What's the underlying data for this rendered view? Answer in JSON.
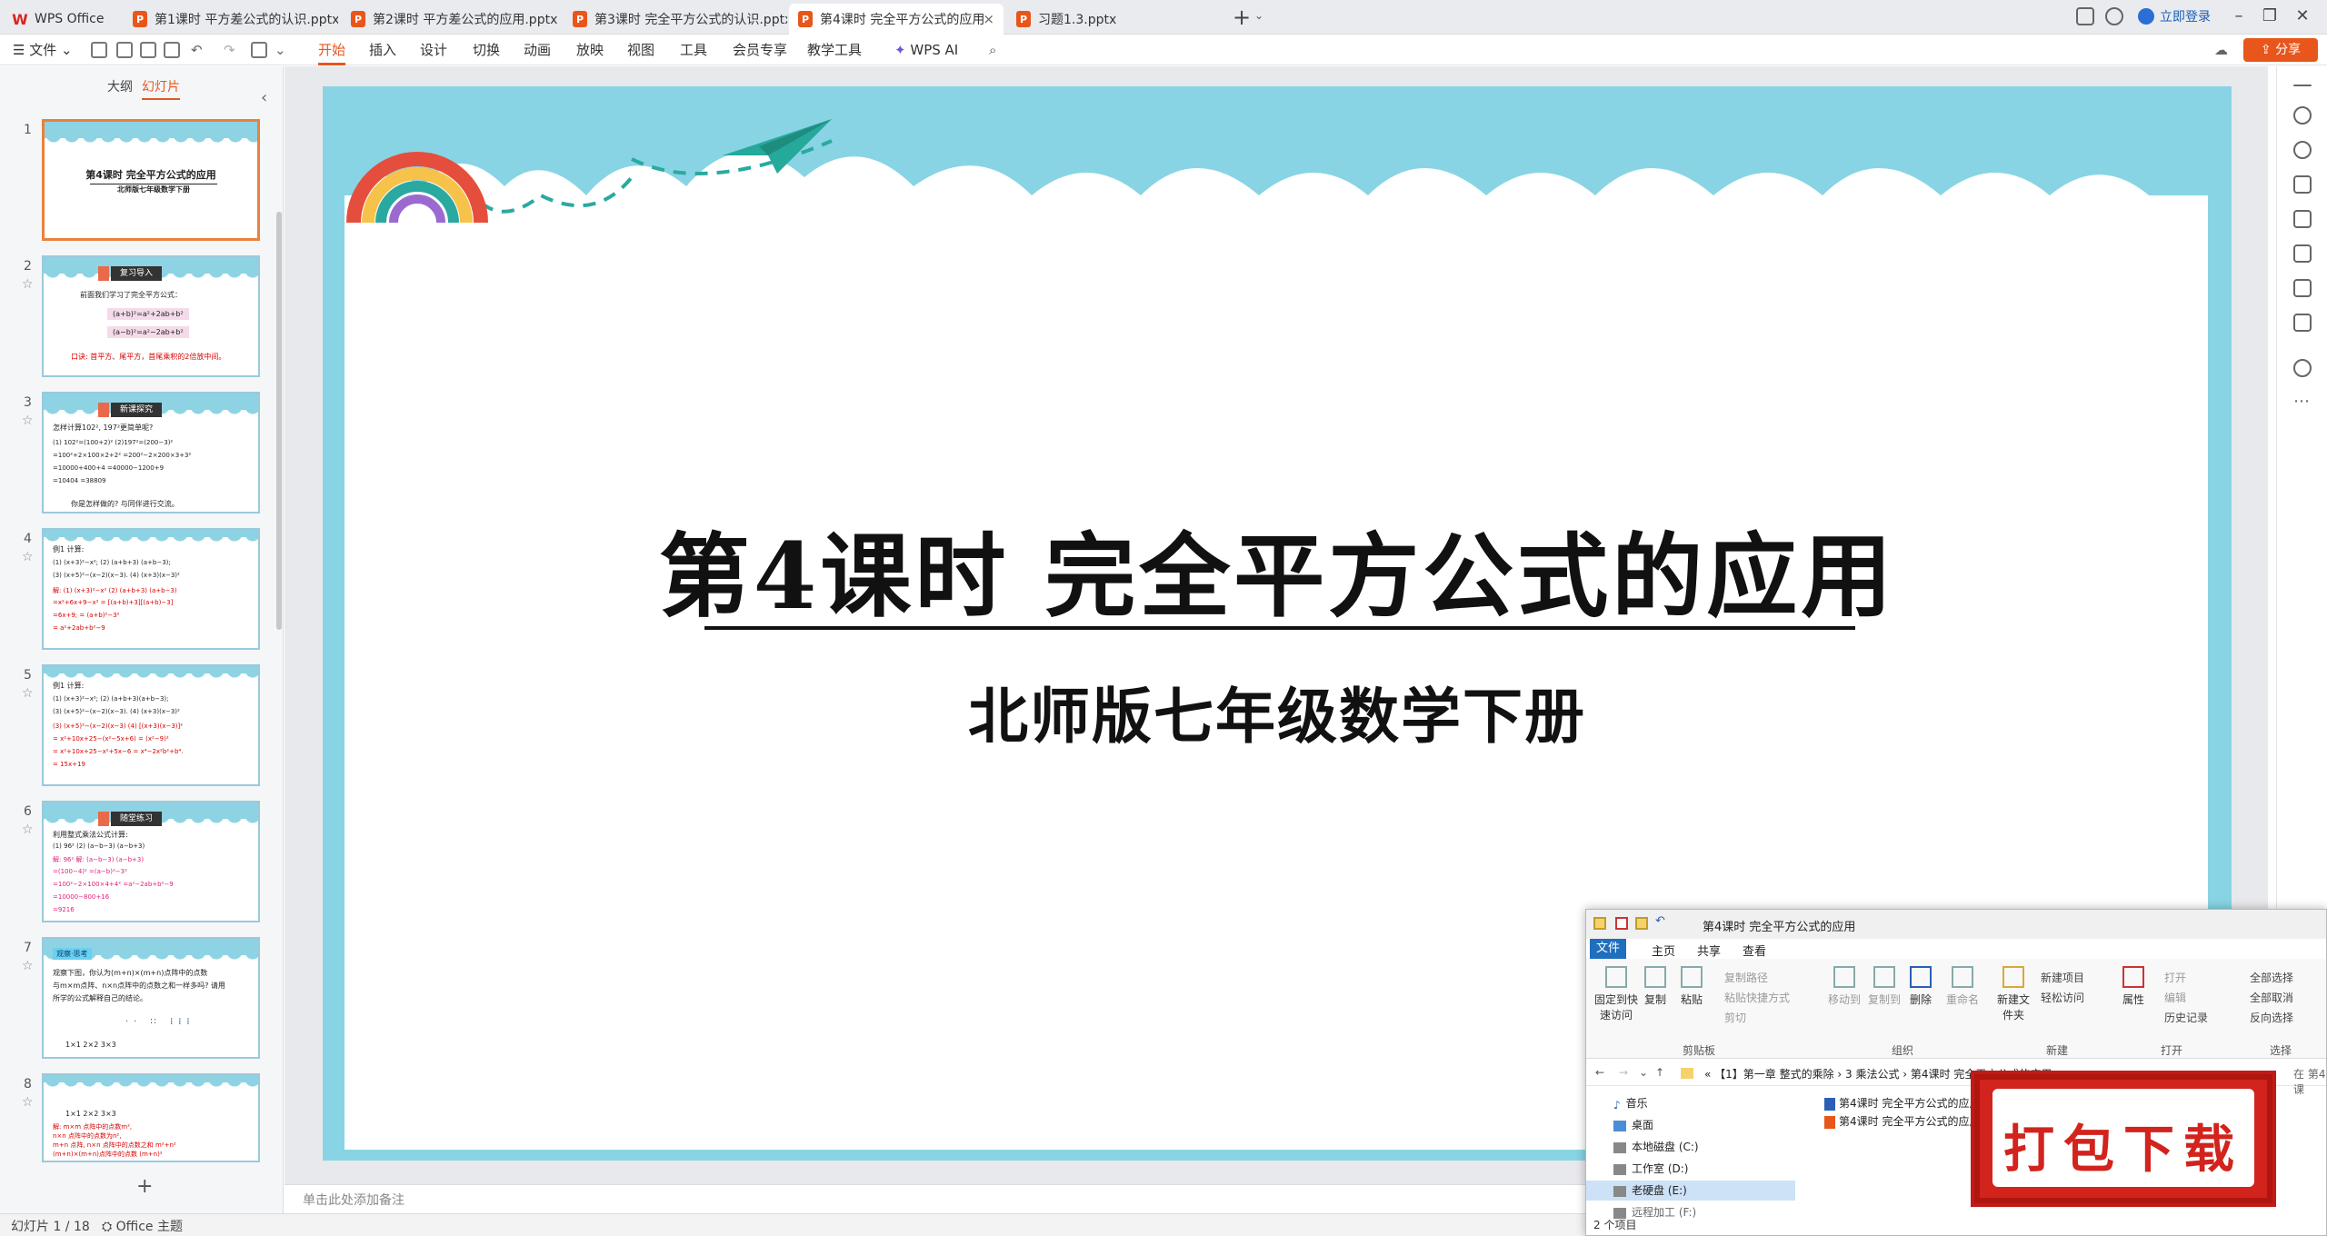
{
  "tabs": [
    {
      "label": "WPS Office",
      "icon": "wps-logo-icon"
    },
    {
      "label": "第1课时  平方差公式的认识.pptx",
      "icon": "P"
    },
    {
      "label": "第2课时  平方差公式的应用.pptx",
      "icon": "P"
    },
    {
      "label": "第3课时  完全平方公式的认识.pptx",
      "icon": "P"
    },
    {
      "label": "第4课时  完全平方公式的应用",
      "icon": "P"
    },
    {
      "label": "习题1.3.pptx",
      "icon": "P"
    }
  ],
  "login_label": "立即登录",
  "menu": {
    "file": "文件",
    "items": [
      "开始",
      "插入",
      "设计",
      "切换",
      "动画",
      "放映",
      "视图",
      "工具",
      "会员专享",
      "教学工具"
    ],
    "wps_ai": "WPS AI",
    "share": "分享"
  },
  "panel": {
    "outline_tab": "大纲",
    "slides_tab": "幻灯片",
    "add_slide": "+"
  },
  "thumbs": [
    {
      "num": "1",
      "title": "第4课时  完全平方公式的应用",
      "subtitle": "北师版七年级数学下册"
    },
    {
      "num": "2",
      "badge": "复习导入",
      "lines": [
        "前面我们学习了完全平方公式：",
        "(a+b)²=a²+2ab+b²",
        "(a−b)²=a²−2ab+b²",
        "口诀: 首平方、尾平方，首尾乘积的2倍放中间。"
      ]
    },
    {
      "num": "3",
      "badge": "新课探究",
      "lines": [
        "怎样计算102², 197²更简单呢?",
        "(1) 102²=(100+2)²       (2)197²=(200−3)²",
        "=100²+2×100×2+2²        =200²−2×200×3+3²",
        "=10000+400+4            =40000−1200+9",
        "=10404                  =38809",
        "你是怎样做的? 与同伴进行交流。"
      ]
    },
    {
      "num": "4",
      "lines": [
        "例1  计算:",
        "(1) (x+3)²−x²;        (2) (a+b+3) (a+b−3);",
        "(3) (x+5)²−(x−2)(x−3).  (4) (x+3)(x−3)²",
        "解: (1) (x+3)²−x²       (2) (a+b+3) (a+b−3)",
        "=x²+6x+9−x²              = [(a+b)+3][(a+b)−3]",
        "=6x+9;                   = (a+b)²−3²",
        "                         = a²+2ab+b²−9"
      ]
    },
    {
      "num": "5",
      "lines": [
        "例1  计算:",
        "(1) (x+3)²−x²;        (2) (a+b+3)(a+b−3);",
        "(3) (x+5)²−(x−2)(x−3).  (4) (x+3)(x−3)²",
        "(3) (x+5)²−(x−2)(x−3)   (4) [(x+3)(x−3)]²",
        "= x²+10x+25−(x²−5x+6)   = (x²−9)²",
        "= x²+10x+25−x²+5x−6     = x⁴−2x²b²+b⁴.",
        "= 15x+19"
      ]
    },
    {
      "num": "6",
      "badge": "随堂练习",
      "lines": [
        "利用整式乘法公式计算:",
        "(1) 96²                (2) (a−b−3) (a−b+3)",
        "解: 96²                 解: (a−b−3) (a−b+3)",
        "=(100−4)²                =(a−b)²−3²",
        "=100²−2×100×4+4²         =a²−2ab+b²−9",
        "=10000−800+16",
        "=9216"
      ]
    },
    {
      "num": "7",
      "badge": "观察·思考",
      "lines": [
        "观察下图，你认为(m+n)×(m+n)点阵中的点数",
        "与m×m点阵、n×n点阵中的点数之和一样多吗? 请用",
        "所学的公式解释自己的结论。",
        "1×1       2×2        3×3"
      ]
    },
    {
      "num": "8",
      "lines": [
        "1×1       2×2        3×3",
        "解: m×m 点阵中的点数m²,",
        "n×n 点阵中的点数为n²,",
        "m+n 点阵, n×n 点阵中的点数之和 m²+n²",
        "(m+n)×(m+n)点阵中的点数 (m+n)²"
      ]
    }
  ],
  "slide": {
    "title": "第4课时  完全平方公式的应用",
    "subtitle": "北师版七年级数学下册"
  },
  "notes_placeholder": "单击此处添加备注",
  "status": {
    "slide_counter": "幻灯片 1 / 18",
    "theme": "Office 主题"
  },
  "explorer": {
    "title": "第4课时  完全平方公式的应用",
    "menu": [
      "文件",
      "主页",
      "共享",
      "查看"
    ],
    "ribbon": {
      "pin": "固定到快速访问",
      "copy": "复制",
      "paste": "粘贴",
      "copy_path": "复制路径",
      "paste_shortcut": "粘贴快捷方式",
      "cut": "剪切",
      "move_to": "移动到",
      "copy_to": "复制到",
      "delete": "删除",
      "rename": "重命名",
      "new_folder": "新建文件夹",
      "new_item": "新建项目",
      "easy_access": "轻松访问",
      "properties": "属性",
      "open": "打开",
      "edit": "编辑",
      "history": "历史记录",
      "select_all": "全部选择",
      "select_none": "全部取消",
      "invert": "反向选择",
      "group_clipboard": "剪贴板",
      "group_organize": "组织",
      "group_new": "新建",
      "group_open": "打开",
      "group_select": "选择"
    },
    "path": "«  【1】第一章 整式的乘除  ›  3 乘法公式  ›  第4课时  完全平方公式的应用  ›",
    "search_hint": "在 第4课",
    "tree": [
      "音乐",
      "桌面",
      "本地磁盘 (C:)",
      "工作室 (D:)",
      "老硬盘 (E:)",
      "远程加工 (F:)"
    ],
    "files": [
      "第4课时  完全平方公式的应用",
      "第4课时  完全平方公式的应用"
    ],
    "status": "2 个项目"
  },
  "promo": "打包下载"
}
